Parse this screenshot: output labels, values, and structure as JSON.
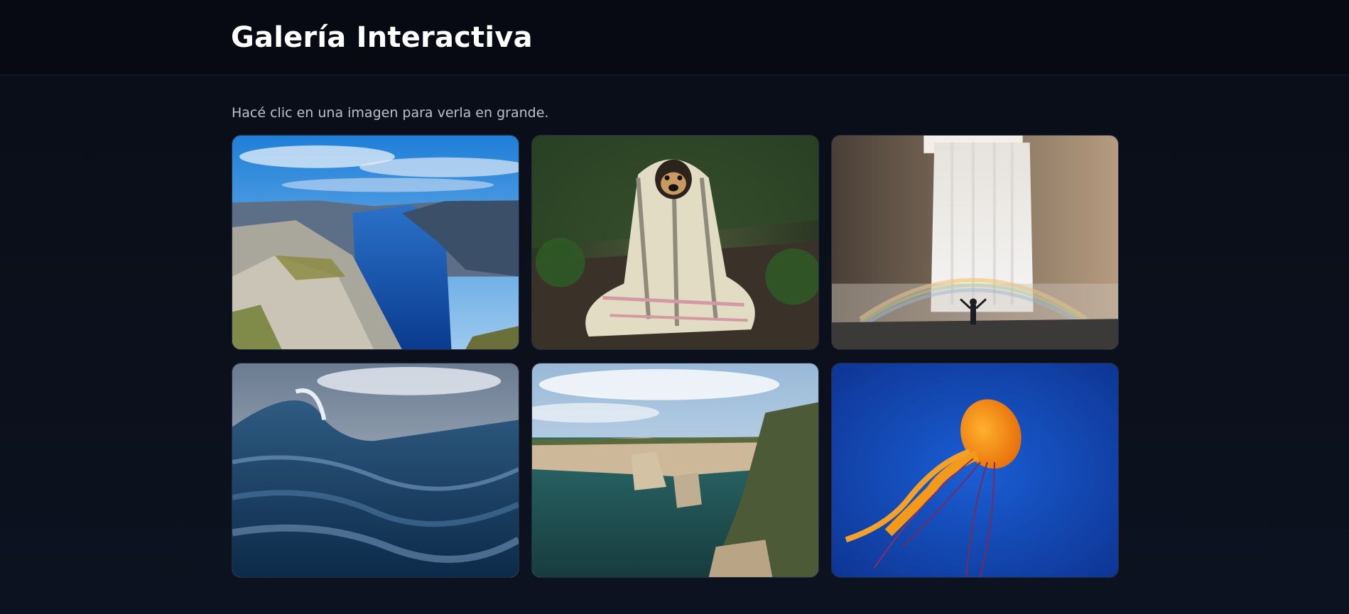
{
  "header": {
    "title": "Galería Interactiva"
  },
  "main": {
    "hint": "Hacé clic en una imagen para verla en grande."
  },
  "gallery": {
    "items": [
      {
        "subject": "fjord-landscape"
      },
      {
        "subject": "pug-in-blanket"
      },
      {
        "subject": "waterfall-rainbow"
      },
      {
        "subject": "ocean-wave"
      },
      {
        "subject": "coastal-cliffs"
      },
      {
        "subject": "orange-jellyfish"
      }
    ]
  }
}
